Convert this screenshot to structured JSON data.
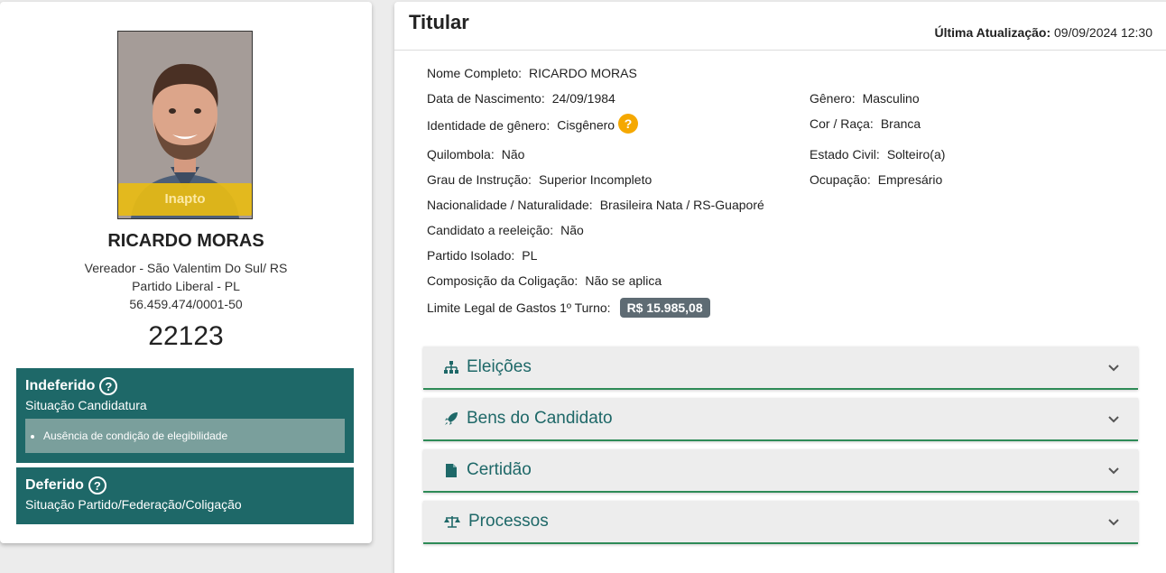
{
  "candidate": {
    "photo_badge": "Inapto",
    "name": "RICARDO MORAS",
    "office": "Vereador - São Valentim Do Sul/ RS",
    "party": "Partido Liberal - PL",
    "cnpj": "56.459.474/0001-50",
    "number": "22123"
  },
  "status": [
    {
      "title": "Indeferido",
      "subtitle": "Situação Candidatura",
      "reasons": [
        "Ausência de condição de elegibilidade"
      ]
    },
    {
      "title": "Deferido",
      "subtitle": "Situação Partido/Federação/Coligação"
    }
  ],
  "header": {
    "title": "Titular",
    "updated_label": "Última Atualização:",
    "updated_value": "09/09/2024 12:30"
  },
  "fields": {
    "full_name": {
      "label": "Nome Completo:",
      "value": "RICARDO MORAS"
    },
    "birth_date": {
      "label": "Data de Nascimento:",
      "value": "24/09/1984"
    },
    "gender_identity": {
      "label": "Identidade de gênero:",
      "value": "Cisgênero"
    },
    "quilombola": {
      "label": "Quilombola:",
      "value": "Não"
    },
    "education": {
      "label": "Grau de Instrução:",
      "value": "Superior Incompleto"
    },
    "nationality": {
      "label": "Nacionalidade / Naturalidade:",
      "value": "Brasileira Nata / RS-Guaporé"
    },
    "reelection": {
      "label": "Candidato a reeleição:",
      "value": "Não"
    },
    "party_isolated": {
      "label": "Partido Isolado:",
      "value": "PL"
    },
    "coalition": {
      "label": "Composição da Coligação:",
      "value": "Não se aplica"
    },
    "spending_limit": {
      "label": "Limite Legal de Gastos 1º Turno:",
      "value": "R$ 15.985,08"
    },
    "gender": {
      "label": "Gênero:",
      "value": "Masculino"
    },
    "race": {
      "label": "Cor / Raça:",
      "value": "Branca"
    },
    "marital_status": {
      "label": "Estado Civil:",
      "value": "Solteiro(a)"
    },
    "occupation": {
      "label": "Ocupação:",
      "value": "Empresário"
    }
  },
  "help_glyph": "?",
  "accordions": [
    {
      "label": "Eleições",
      "icon": "sitemap-icon"
    },
    {
      "label": "Bens do Candidato",
      "icon": "rocket-icon"
    },
    {
      "label": "Certidão",
      "icon": "file-icon"
    },
    {
      "label": "Processos",
      "icon": "balance-scale-icon"
    }
  ],
  "colors": {
    "status_bg": "#1e6868",
    "accent_help": "#f5a800",
    "accordion_border": "#2e8b57",
    "badge_inapto": "#e8bc14"
  }
}
